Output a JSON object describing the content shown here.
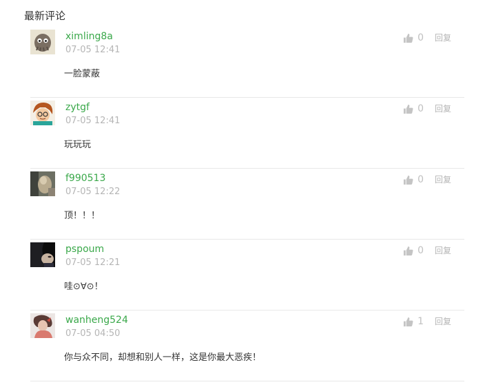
{
  "section": {
    "title": "最新评论"
  },
  "comments": [
    {
      "username": "ximling8a",
      "time": "07-05 12:41",
      "content": "一脸蒙蔽",
      "likes": "0",
      "reply": "回复"
    },
    {
      "username": "zytgf",
      "time": "07-05 12:41",
      "content": "玩玩玩",
      "likes": "0",
      "reply": "回复"
    },
    {
      "username": "f990513",
      "time": "07-05 12:22",
      "content": "顶！！！",
      "likes": "0",
      "reply": "回复"
    },
    {
      "username": "pspoum",
      "time": "07-05 12:21",
      "content": "哇⊙∀⊙！",
      "likes": "0",
      "reply": "回复"
    },
    {
      "username": "wanheng524",
      "time": "07-05 04:50",
      "content": "你与众不同，却想和别人一样，这是你最大恶疾！",
      "likes": "1",
      "reply": "回复"
    }
  ],
  "icons": {
    "like": "thumbs-up-icon"
  },
  "colors": {
    "username": "#3aa84a",
    "muted": "#b5b5b5",
    "text": "#333333",
    "divider": "#e8e8e8"
  }
}
